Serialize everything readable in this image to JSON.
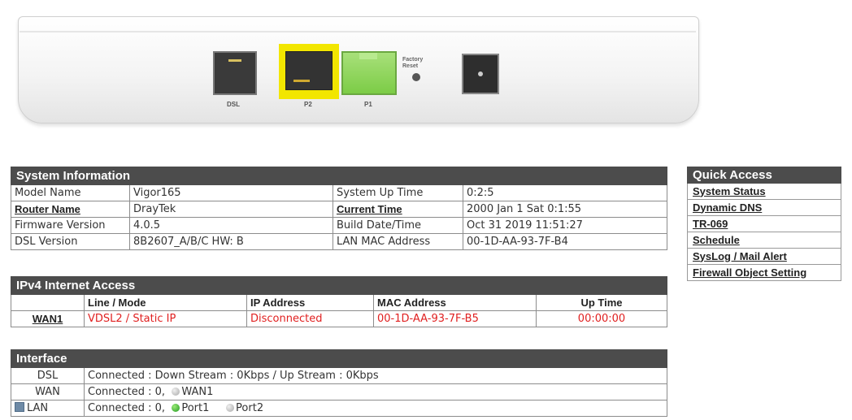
{
  "panel": {
    "port_labels": {
      "dsl": "DSL",
      "p2": "P2",
      "p1": "P1"
    },
    "factory_reset": [
      "Factory",
      "Reset"
    ]
  },
  "system_information": {
    "title": "System Information",
    "rows": [
      {
        "l1": "Model Name",
        "v1": "Vigor165",
        "l2": "System Up Time",
        "v2": "0:2:5"
      },
      {
        "l1": "Router Name",
        "v1": "DrayTek",
        "l2": "Current Time",
        "v2": "2000 Jan 1 Sat 0:1:55"
      },
      {
        "l1": "Firmware Version",
        "v1": "4.0.5",
        "l2": "Build Date/Time",
        "v2": "Oct 31 2019 11:51:27"
      },
      {
        "l1": "DSL Version",
        "v1": "8B2607_A/B/C HW: B",
        "l2": "LAN MAC Address",
        "v2": "00-1D-AA-93-7F-B4"
      }
    ]
  },
  "ipv4": {
    "title": "IPv4 Internet Access",
    "columns": [
      "Line / Mode",
      "IP Address",
      "MAC Address",
      "Up Time"
    ],
    "rows": [
      {
        "name": "WAN1",
        "line_mode": "VDSL2 / Static IP",
        "ip": "Disconnected",
        "mac": "00-1D-AA-93-7F-B5",
        "uptime": "00:00:00"
      }
    ]
  },
  "interface": {
    "title": "Interface",
    "dsl": {
      "name": "DSL",
      "status": "Connected : Down Stream : 0Kbps / Up Stream : 0Kbps"
    },
    "wan": {
      "name": "WAN",
      "status": "Connected :  0,",
      "port": "WAN1"
    },
    "lan": {
      "name": "LAN",
      "status": "Connected :  0,",
      "port1": "Port1",
      "port2": "Port2"
    }
  },
  "quick_access": {
    "title": "Quick Access",
    "items": [
      "System Status",
      "Dynamic DNS",
      "TR-069",
      "Schedule",
      "SysLog / Mail Alert",
      "Firewall Object Setting"
    ]
  },
  "colors": {
    "header_bg": "#4c4c4c",
    "alert_red": "#e02020",
    "p2_highlight": "#f2e600",
    "p1_active": "#7ccc46"
  }
}
